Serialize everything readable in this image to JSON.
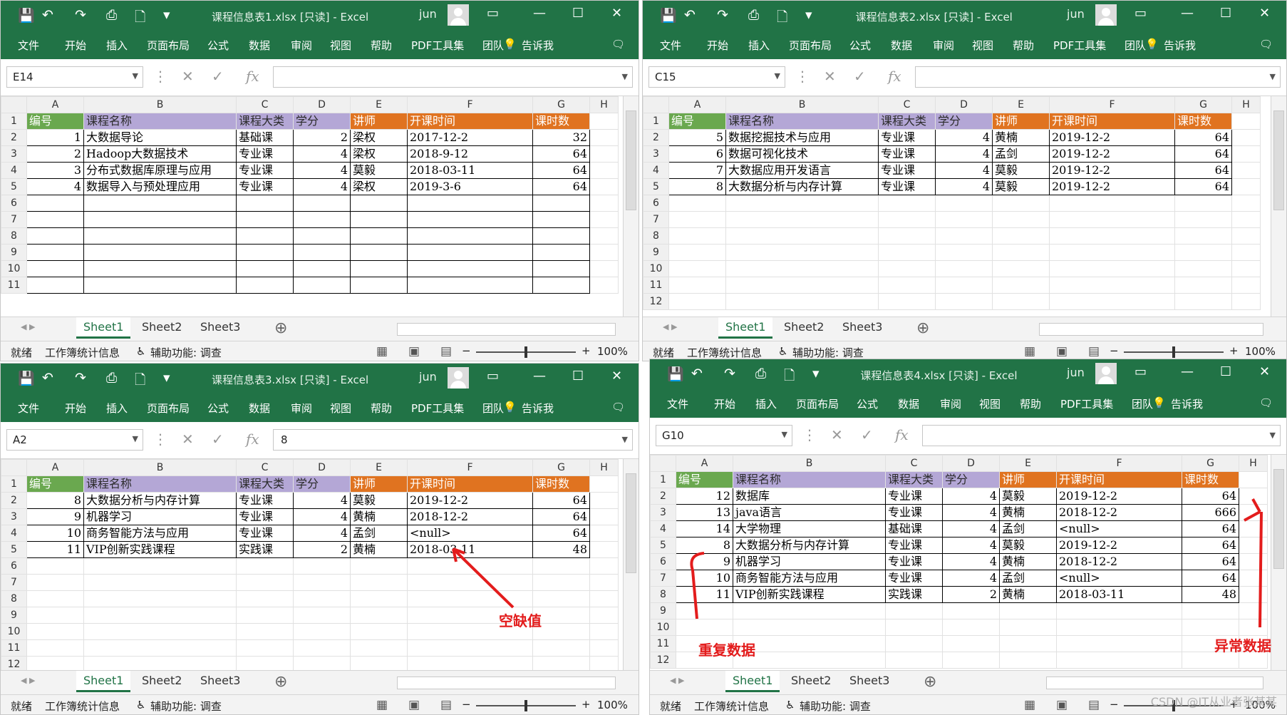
{
  "windows": [
    {
      "title": "课程信息表1.xlsx  [只读]  -  Excel",
      "user": "jun",
      "cell_ref": "E14",
      "formula": "",
      "columns": [
        "A",
        "B",
        "C",
        "D",
        "E",
        "F",
        "G",
        "H"
      ],
      "header_row": [
        "编号",
        "课程名称",
        "课程大类",
        "学分",
        "讲师",
        "开课时间",
        "课时数"
      ],
      "rows": [
        [
          "1",
          "大数据导论",
          "基础课",
          "2",
          "梁权",
          "2017-12-2",
          "32"
        ],
        [
          "2",
          "Hadoop大数据技术",
          "专业课",
          "4",
          "梁权",
          "2018-9-12",
          "64"
        ],
        [
          "3",
          "分布式数据库原理与应用",
          "专业课",
          "4",
          "莫毅",
          "2018-03-11",
          "64"
        ],
        [
          "4",
          "数据导入与预处理应用",
          "专业课",
          "4",
          "梁权",
          "2019-3-6",
          "64"
        ]
      ],
      "row_numbers": [
        "1",
        "2",
        "3",
        "4",
        "5",
        "6",
        "7",
        "8",
        "9",
        "10",
        "11"
      ],
      "sheets": [
        "Sheet1",
        "Sheet2",
        "Sheet3"
      ],
      "status_ready": "就绪",
      "status_stats": "工作簿统计信息",
      "status_access": "辅助功能: 调查",
      "zoom": "100%"
    },
    {
      "title": "课程信息表2.xlsx  [只读]  -  Excel",
      "user": "jun",
      "cell_ref": "C15",
      "formula": "",
      "columns": [
        "A",
        "B",
        "C",
        "D",
        "E",
        "F",
        "G",
        "H"
      ],
      "header_row": [
        "编号",
        "课程名称",
        "课程大类",
        "学分",
        "讲师",
        "开课时间",
        "课时数"
      ],
      "rows": [
        [
          "5",
          "数据挖掘技术与应用",
          "专业课",
          "4",
          "黄楠",
          "2019-12-2",
          "64"
        ],
        [
          "6",
          "数据可视化技术",
          "专业课",
          "4",
          "孟剑",
          "2019-12-2",
          "64"
        ],
        [
          "7",
          "大数据应用开发语言",
          "专业课",
          "4",
          "莫毅",
          "2019-12-2",
          "64"
        ],
        [
          "8",
          "大数据分析与内存计算",
          "专业课",
          "4",
          "莫毅",
          "2019-12-2",
          "64"
        ]
      ],
      "row_numbers": [
        "1",
        "2",
        "3",
        "4",
        "5",
        "6",
        "7",
        "8",
        "9",
        "10",
        "11",
        "12"
      ],
      "sheets": [
        "Sheet1",
        "Sheet2",
        "Sheet3"
      ],
      "status_ready": "就绪",
      "status_stats": "工作簿统计信息",
      "status_access": "辅助功能: 调查",
      "zoom": "100%"
    },
    {
      "title": "课程信息表3.xlsx  [只读]  -  Excel",
      "user": "jun",
      "cell_ref": "A2",
      "formula": "8",
      "columns": [
        "A",
        "B",
        "C",
        "D",
        "E",
        "F",
        "G",
        "H"
      ],
      "header_row": [
        "编号",
        "课程名称",
        "课程大类",
        "学分",
        "讲师",
        "开课时间",
        "课时数"
      ],
      "rows": [
        [
          "8",
          "大数据分析与内存计算",
          "专业课",
          "4",
          "莫毅",
          "2019-12-2",
          "64"
        ],
        [
          "9",
          "机器学习",
          "专业课",
          "4",
          "黄楠",
          "2018-12-2",
          "64"
        ],
        [
          "10",
          "商务智能方法与应用",
          "专业课",
          "4",
          "孟剑",
          "<null>",
          "64"
        ],
        [
          "11",
          "VIP创新实践课程",
          "实践课",
          "2",
          "黄楠",
          "2018-03-11",
          "48"
        ]
      ],
      "row_numbers": [
        "1",
        "2",
        "3",
        "4",
        "5",
        "6",
        "7",
        "8",
        "9",
        "10",
        "11",
        "12"
      ],
      "sheets": [
        "Sheet1",
        "Sheet2",
        "Sheet3"
      ],
      "status_ready": "就绪",
      "status_stats": "工作簿统计信息",
      "status_access": "辅助功能: 调查",
      "zoom": "100%",
      "annotation": "空缺值"
    },
    {
      "title": "课程信息表4.xlsx  [只读]  -  Excel",
      "user": "jun",
      "cell_ref": "G10",
      "formula": "",
      "columns": [
        "A",
        "B",
        "C",
        "D",
        "E",
        "F",
        "G",
        "H"
      ],
      "header_row": [
        "编号",
        "课程名称",
        "课程大类",
        "学分",
        "讲师",
        "开课时间",
        "课时数"
      ],
      "rows": [
        [
          "12",
          "数据库",
          "专业课",
          "4",
          "莫毅",
          "2019-12-2",
          "64"
        ],
        [
          "13",
          "java语言",
          "专业课",
          "4",
          "黄楠",
          "2018-12-2",
          "666"
        ],
        [
          "14",
          "大学物理",
          "基础课",
          "4",
          "孟剑",
          "<null>",
          "64"
        ],
        [
          "8",
          "大数据分析与内存计算",
          "专业课",
          "4",
          "莫毅",
          "2019-12-2",
          "64"
        ],
        [
          "9",
          "机器学习",
          "专业课",
          "4",
          "黄楠",
          "2018-12-2",
          "64"
        ],
        [
          "10",
          "商务智能方法与应用",
          "专业课",
          "4",
          "孟剑",
          "<null>",
          "64"
        ],
        [
          "11",
          "VIP创新实践课程",
          "实践课",
          "2",
          "黄楠",
          "2018-03-11",
          "48"
        ]
      ],
      "row_numbers": [
        "1",
        "2",
        "3",
        "4",
        "5",
        "6",
        "7",
        "8",
        "9",
        "10",
        "11",
        "12"
      ],
      "sheets": [
        "Sheet1",
        "Sheet2",
        "Sheet3"
      ],
      "status_ready": "就绪",
      "status_stats": "工作簿统计信息",
      "status_access": "辅助功能: 调查",
      "zoom": "100%",
      "annotation_dup": "重复数据",
      "annotation_abn": "异常数据"
    }
  ],
  "ribbon_menu": [
    "文件",
    "开始",
    "插入",
    "页面布局",
    "公式",
    "数据",
    "审阅",
    "视图",
    "帮助",
    "PDF工具集",
    "团队",
    "告诉我"
  ],
  "fx_label": "fx",
  "watermark": "CSDN @IT从业者张某某",
  "colors": {
    "excel_green": "#217346",
    "header_purple": "#b4a7d6",
    "header_green": "#6aa84f",
    "header_orange": "#e07320",
    "annotation_red": "#e31c1c"
  }
}
